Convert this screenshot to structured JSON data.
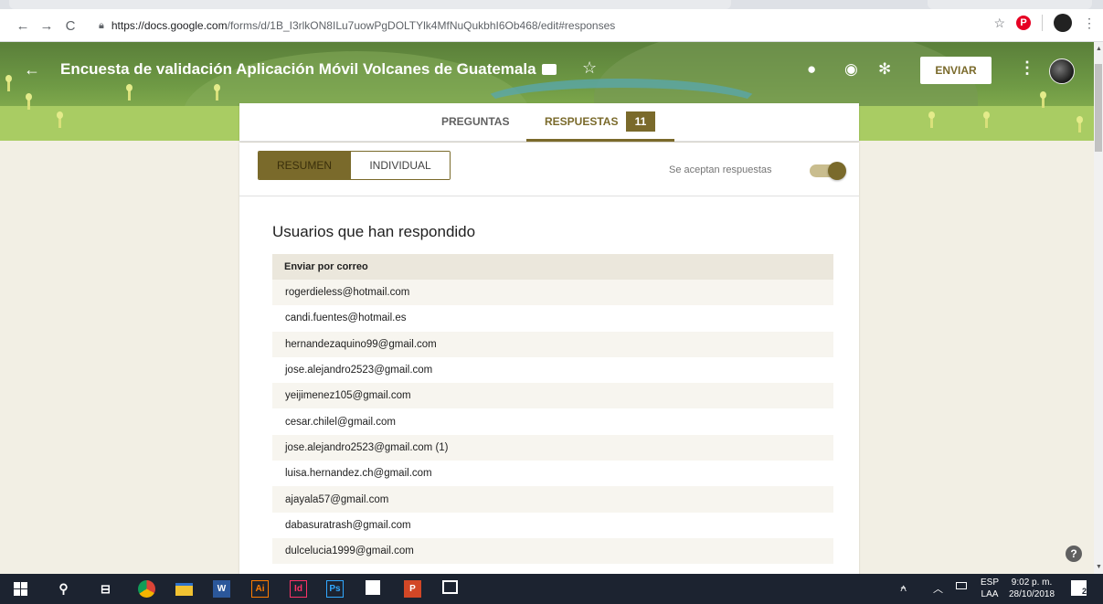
{
  "browser": {
    "url_host": "https://docs.google.com",
    "url_path": "/forms/d/1B_I3rlkON8ILu7uowPgDOLTYlk4MfNuQukbhI6Ob468/edit#responses",
    "icons": [
      "back-arrow-icon",
      "forward-arrow-icon",
      "reload-icon",
      "lock-icon",
      "star-icon",
      "pinterest-icon",
      "profile-avatar",
      "menu-dots-icon"
    ]
  },
  "header": {
    "title": "Encuesta de validación Aplicación Móvil Volcanes de Guatemala",
    "send_label": "ENVIAR",
    "icons": [
      "back-arrow-icon",
      "folder-icon",
      "star-icon",
      "palette-icon",
      "eye-icon",
      "gear-icon",
      "more-vert-icon",
      "avatar"
    ]
  },
  "tabs": {
    "questions": "PREGUNTAS",
    "responses": "RESPUESTAS",
    "responses_count": "11"
  },
  "responses": {
    "summary_label": "RESUMEN",
    "individual_label": "INDIVIDUAL",
    "accepting_label": "Se aceptan respuestas",
    "accepting": true,
    "section_title": "Usuarios que han respondido",
    "list_header": "Enviar por correo",
    "emails": [
      "rogerdieless@hotmail.com",
      "candi.fuentes@hotmail.es",
      "hernandezaquino99@gmail.com",
      "jose.alejandro2523@gmail.com",
      "yeijimenez105@gmail.com",
      "cesar.chilel@gmail.com",
      "jose.alejandro2523@gmail.com (1)",
      "luisa.hernandez.ch@gmail.com",
      "ajayala57@gmail.com",
      "dabasuratrash@gmail.com",
      "dulcelucia1999@gmail.com"
    ]
  },
  "help": "?",
  "taskbar": {
    "apps": [
      {
        "name": "chrome",
        "label": "",
        "color": "#f4b400"
      },
      {
        "name": "file-explorer",
        "label": "",
        "color": "#f1c232"
      },
      {
        "name": "word",
        "label": "W",
        "color": "#2b579a"
      },
      {
        "name": "illustrator",
        "label": "Ai",
        "color": "#ff7c00"
      },
      {
        "name": "indesign",
        "label": "Id",
        "color": "#ff3366"
      },
      {
        "name": "photoshop",
        "label": "Ps",
        "color": "#31a8ff"
      },
      {
        "name": "sticky",
        "label": "",
        "color": "#ffffff"
      },
      {
        "name": "powerpoint",
        "label": "P",
        "color": "#d24726"
      },
      {
        "name": "photos",
        "label": "",
        "color": "#ffffff"
      }
    ],
    "lang_top": "ESP",
    "lang_bottom": "LAA",
    "time": "9:02 p. m.",
    "date": "28/10/2018",
    "notifications": "2"
  },
  "colors": {
    "accent": "#7a6a2b",
    "background": "#f2efe4"
  }
}
